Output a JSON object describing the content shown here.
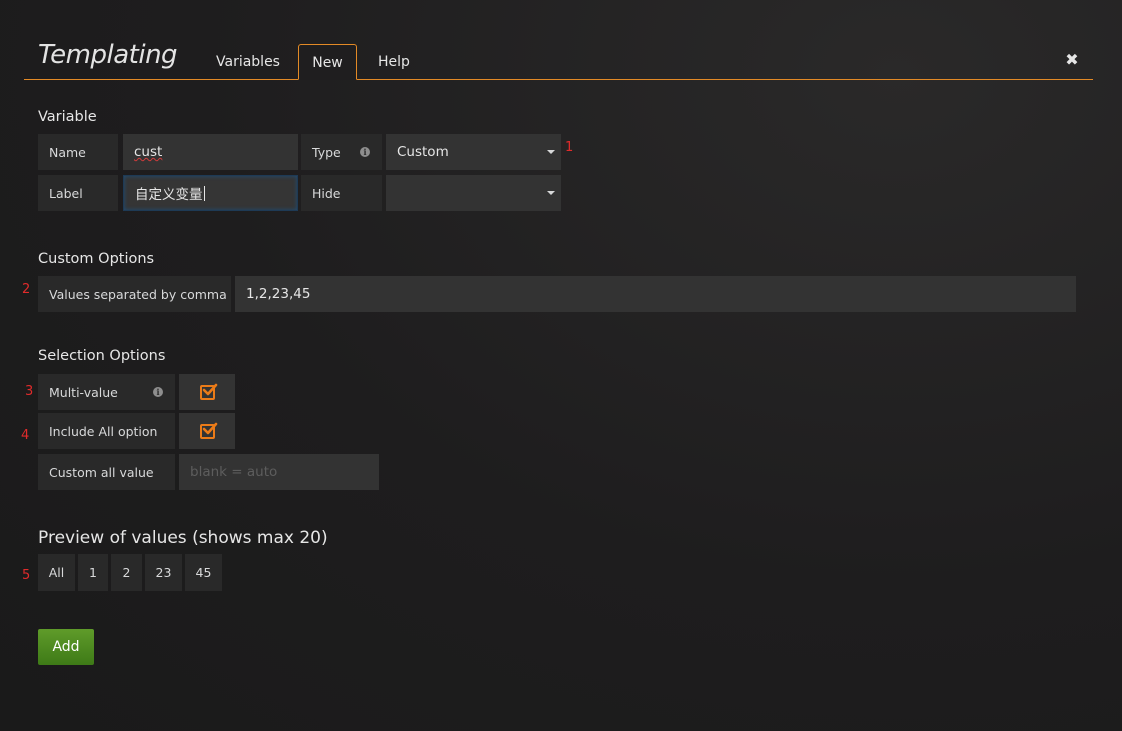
{
  "header": {
    "title": "Templating",
    "tabs": [
      {
        "label": "Variables",
        "active": false
      },
      {
        "label": "New",
        "active": true
      },
      {
        "label": "Help",
        "active": false
      }
    ],
    "close_icon": "close-icon"
  },
  "variable": {
    "section_title": "Variable",
    "name_label": "Name",
    "name_value": "cust",
    "type_label": "Type",
    "type_value": "Custom",
    "label_label": "Label",
    "label_value": "自定义变量",
    "hide_label": "Hide",
    "hide_value": ""
  },
  "custom_options": {
    "section_title": "Custom Options",
    "values_label": "Values separated by comma",
    "values_value": "1,2,23,45"
  },
  "selection_options": {
    "section_title": "Selection Options",
    "multi_value_label": "Multi-value",
    "multi_value_checked": true,
    "include_all_label": "Include All option",
    "include_all_checked": true,
    "custom_all_label": "Custom all value",
    "custom_all_placeholder": "blank = auto"
  },
  "preview": {
    "section_title": "Preview of values (shows max 20)",
    "values": [
      "All",
      "1",
      "2",
      "23",
      "45"
    ]
  },
  "add_button_label": "Add",
  "markers": [
    "1",
    "2",
    "3",
    "4",
    "5"
  ],
  "colors": {
    "accent": "#e38a26",
    "checkbox": "#eb7b18",
    "add_button": "#4f8a22",
    "marker": "#e02b2b"
  }
}
